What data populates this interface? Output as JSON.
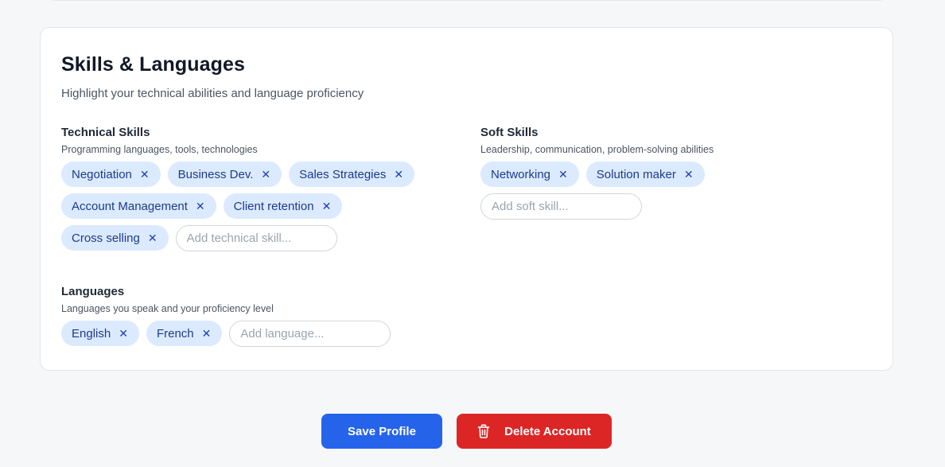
{
  "card": {
    "title": "Skills & Languages",
    "subtitle": "Highlight your technical abilities and language proficiency"
  },
  "technical": {
    "title": "Technical Skills",
    "hint": "Programming languages, tools, technologies",
    "tags": [
      "Negotiation",
      "Business Dev.",
      "Sales Strategies",
      "Account Management",
      "Client retention",
      "Cross selling"
    ],
    "placeholder": "Add technical skill..."
  },
  "soft": {
    "title": "Soft Skills",
    "hint": "Leadership, communication, problem-solving abilities",
    "tags": [
      "Networking",
      "Solution maker"
    ],
    "placeholder": "Add soft skill..."
  },
  "languages": {
    "title": "Languages",
    "hint": "Languages you speak and your proficiency level",
    "tags": [
      "English",
      "French"
    ],
    "placeholder": "Add language..."
  },
  "remove_glyph": "✕",
  "actions": {
    "save_label": "Save Profile",
    "delete_label": "Delete Account",
    "delete_icon": "trash-icon"
  },
  "colors": {
    "primary": "#2563eb",
    "danger": "#dc2626",
    "chip_bg": "#dbeafe",
    "chip_text": "#1e3a8a"
  }
}
